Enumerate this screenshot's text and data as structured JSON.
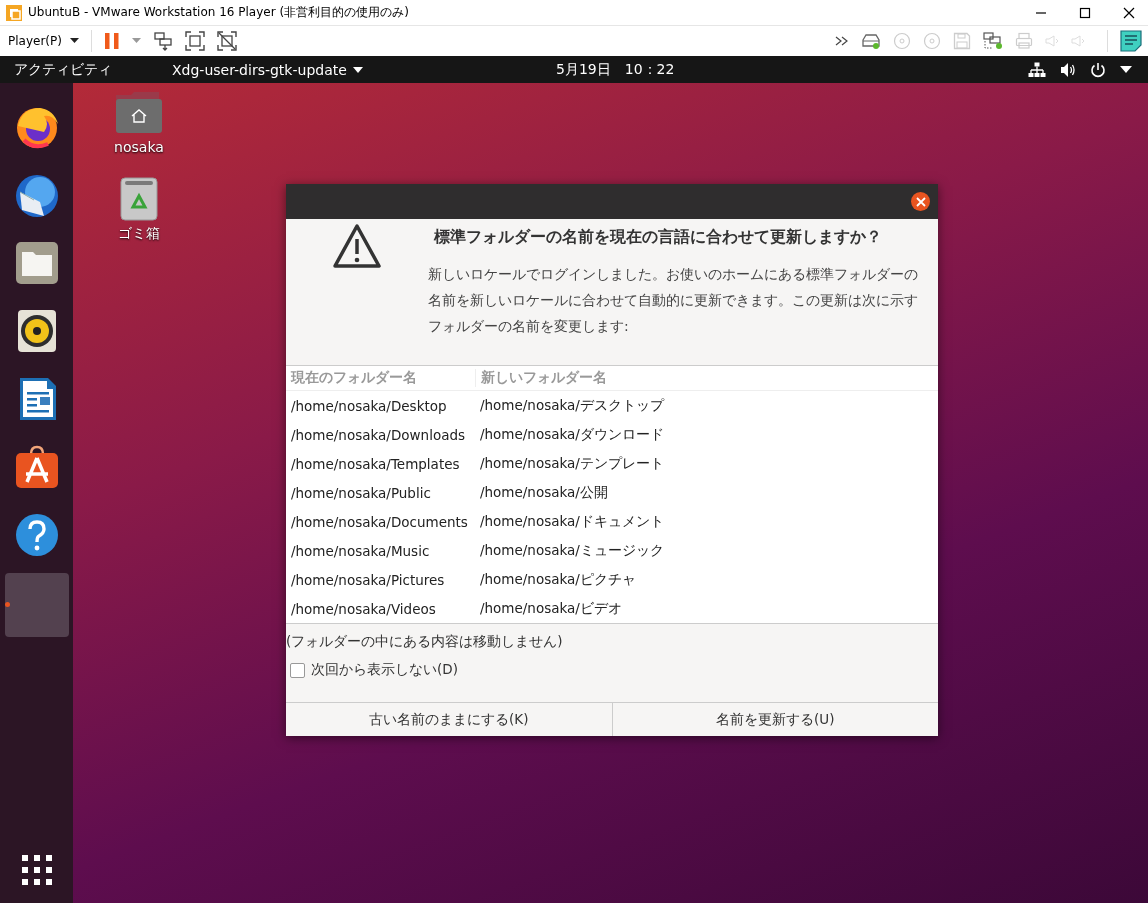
{
  "window": {
    "title": "UbuntuB - VMware Workstation 16 Player (非営利目的の使用のみ)"
  },
  "toolbar": {
    "menu": "Player(P)"
  },
  "top_panel": {
    "activities": "アクティビティ",
    "app_menu": "Xdg-user-dirs-gtk-update",
    "clock": "5月19日　10：22"
  },
  "dock": {
    "items": [
      {
        "kind": "browser",
        "active": false
      },
      {
        "kind": "mail",
        "active": false
      },
      {
        "kind": "files",
        "active": false
      },
      {
        "kind": "music",
        "active": false
      },
      {
        "kind": "writer",
        "active": false
      },
      {
        "kind": "store",
        "active": false
      },
      {
        "kind": "help",
        "active": false
      },
      {
        "kind": "blank",
        "active": true
      }
    ]
  },
  "desktop_icons": [
    {
      "kind": "home",
      "label": "nosaka"
    },
    {
      "kind": "trash",
      "label": "ゴミ箱"
    }
  ],
  "dialog": {
    "heading": "標準フォルダーの名前を現在の言語に合わせて更新しますか？",
    "message": "新しいロケールでログインしました。お使いのホームにある標準フォルダーの名前を新しいロケールに合わせて自動的に更新できます。この更新は次に示すフォルダーの名前を変更します:",
    "table": {
      "columns": [
        "現在のフォルダー名",
        "新しいフォルダー名"
      ],
      "rows": [
        [
          "/home/nosaka/Desktop",
          "/home/nosaka/デスクトップ"
        ],
        [
          "/home/nosaka/Downloads",
          "/home/nosaka/ダウンロード"
        ],
        [
          "/home/nosaka/Templates",
          "/home/nosaka/テンプレート"
        ],
        [
          "/home/nosaka/Public",
          "/home/nosaka/公開"
        ],
        [
          "/home/nosaka/Documents",
          "/home/nosaka/ドキュメント"
        ],
        [
          "/home/nosaka/Music",
          "/home/nosaka/ミュージック"
        ],
        [
          "/home/nosaka/Pictures",
          "/home/nosaka/ピクチャ"
        ],
        [
          "/home/nosaka/Videos",
          "/home/nosaka/ビデオ"
        ]
      ]
    },
    "note": "(フォルダーの中にある内容は移動しません)",
    "checkbox": {
      "label": "次回から表示しない(D)",
      "checked": false
    },
    "buttons": [
      "古い名前のままにする(K)",
      "名前を更新する(U)"
    ]
  }
}
